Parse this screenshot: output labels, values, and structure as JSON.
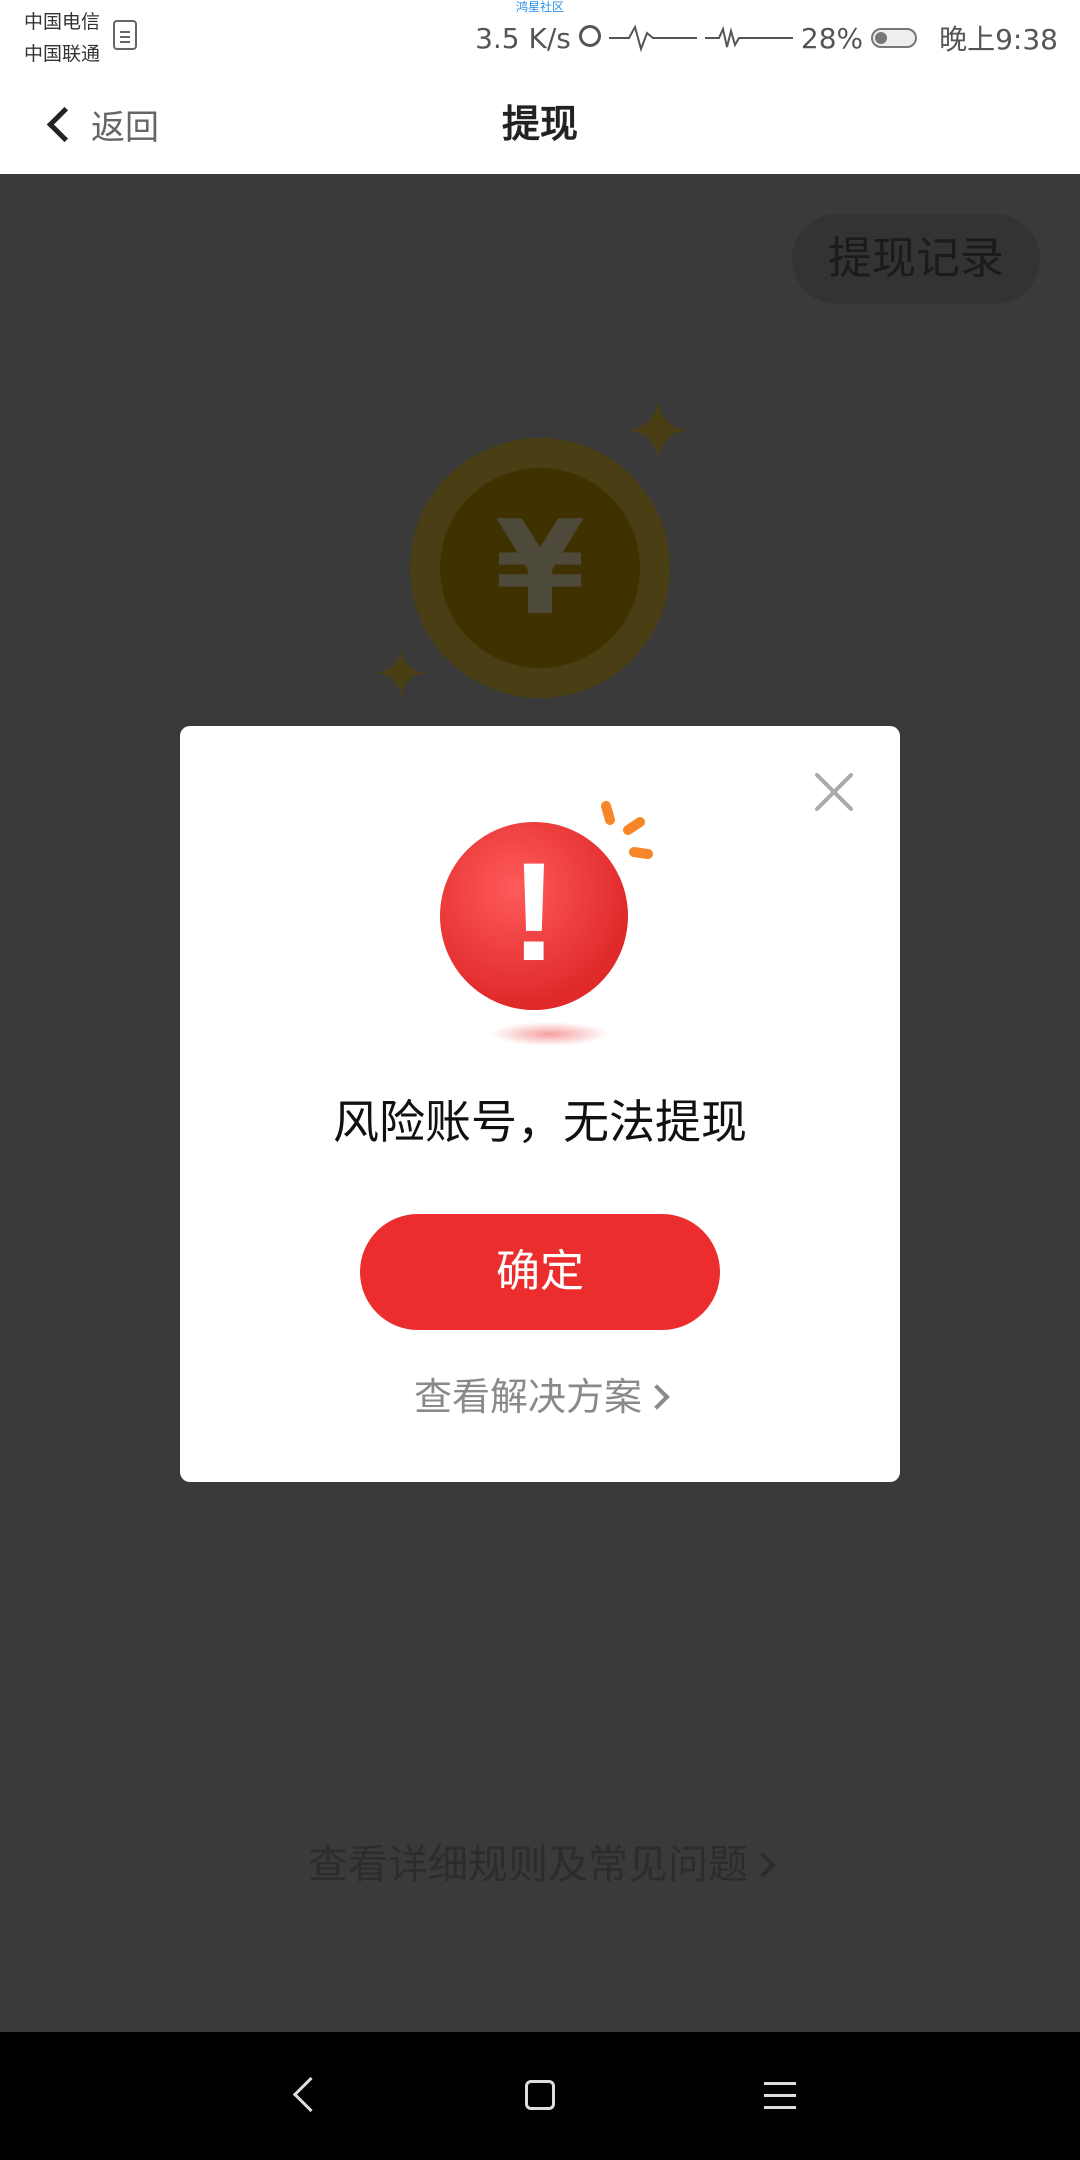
{
  "status_bar": {
    "carrier_1": "中国电信",
    "carrier_2": "中国联通",
    "watermark": "鸿星社区",
    "speed": "3.5 K/s",
    "battery": "28%",
    "time": "晚上9:38"
  },
  "header": {
    "back_label": "返回",
    "title": "提现"
  },
  "page": {
    "records_button": "提现记录",
    "coin_symbol": "¥",
    "rules_link": "查看详细规则及常见问题"
  },
  "modal": {
    "message": "风险账号，无法提现",
    "confirm_label": "确定",
    "solution_link": "查看解决方案"
  },
  "colors": {
    "accent_red": "#eb2d2d",
    "overlay": "#3a3a3a",
    "coin_gold": "#4a3f14"
  },
  "icons": [
    "sim-card-icon",
    "alarm-icon",
    "battery-icon",
    "back-chevron-icon",
    "close-icon",
    "alert-icon",
    "sparkle-icon",
    "nav-back-icon",
    "nav-home-icon",
    "nav-menu-icon"
  ]
}
